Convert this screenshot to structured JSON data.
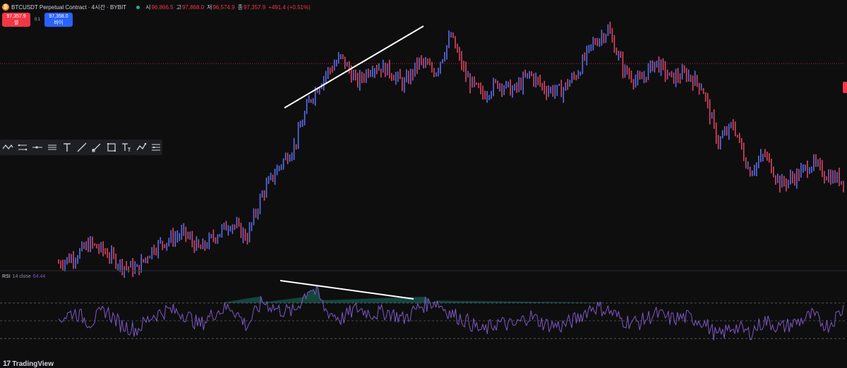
{
  "header": {
    "symbol_icon": "bitcoin-icon",
    "title": "BTCUSDT Perpetual Contract · 4시간 · BYBIT",
    "ohlc": [
      {
        "label": "시",
        "value": "96,866.5"
      },
      {
        "label": "고",
        "value": "97,868.0"
      },
      {
        "label": "저",
        "value": "96,574.9"
      },
      {
        "label": "종",
        "value": "97,357.9"
      }
    ],
    "change": "+491.4 (+0.51%)"
  },
  "trade": {
    "sell_price": "97,357.9",
    "sell_label": "셀",
    "spread": "0.1",
    "buy_price": "97,358.0",
    "buy_label": "바이"
  },
  "toolbar": {
    "icons": [
      "pattern-icon",
      "channel-icon",
      "horizontal-ray-icon",
      "parallel-lines-icon",
      "text-icon",
      "trend-line-icon",
      "brush-icon",
      "rectangle-icon",
      "text-size-icon",
      "path-icon",
      "settings-lines-icon"
    ]
  },
  "rsi": {
    "name": "RSI",
    "params": "14 close",
    "value": "64.44"
  },
  "logo": {
    "text": "TradingView"
  },
  "colors": {
    "background": "#0e0e0f",
    "up": "#5b6ee8",
    "down": "#e0455e",
    "rsi_line": "#7e57c2",
    "trendline": "#ffffff",
    "price_line": "#f23645"
  },
  "chart_data": [
    {
      "type": "line",
      "title": "BTCUSDT Perpetual Contract · 4시간 · BYBIT",
      "x_index_range": [
        0,
        100
      ],
      "series": [
        {
          "name": "BTCUSDT",
          "x": [
            0,
            2,
            4,
            6,
            8,
            10,
            12,
            14,
            16,
            18,
            20,
            22,
            24,
            26,
            28,
            30,
            32,
            33,
            34,
            36,
            38,
            40,
            42,
            44,
            46,
            48,
            50,
            52,
            54,
            56,
            58,
            60,
            62,
            64,
            66,
            68,
            70,
            72,
            74,
            76,
            78,
            80,
            82,
            84,
            86,
            88,
            90,
            92,
            94,
            96,
            98,
            100
          ],
          "values": [
            3,
            6,
            12,
            8,
            2,
            0,
            10,
            14,
            17,
            9,
            16,
            22,
            15,
            36,
            48,
            58,
            80,
            86,
            92,
            100,
            88,
            96,
            94,
            87,
            98,
            93,
            110,
            90,
            82,
            88,
            84,
            92,
            85,
            84,
            92,
            106,
            113,
            94,
            88,
            98,
            90,
            92,
            86,
            60,
            68,
            46,
            54,
            40,
            44,
            50,
            44,
            42
          ]
        }
      ],
      "price_line_value": 97
    },
    {
      "type": "line",
      "title": "RSI 14 close",
      "ylim": [
        0,
        100
      ],
      "series": [
        {
          "name": "RSI",
          "x": [
            0,
            2,
            4,
            6,
            8,
            10,
            12,
            14,
            16,
            18,
            20,
            22,
            24,
            26,
            28,
            30,
            32,
            33,
            34,
            36,
            38,
            40,
            42,
            44,
            46,
            48,
            50,
            52,
            54,
            56,
            58,
            60,
            62,
            64,
            66,
            68,
            70,
            72,
            74,
            76,
            78,
            80,
            82,
            84,
            86,
            88,
            90,
            92,
            94,
            96,
            98,
            100
          ],
          "values": [
            52,
            60,
            48,
            62,
            45,
            40,
            56,
            62,
            58,
            45,
            60,
            66,
            44,
            72,
            62,
            60,
            88,
            80,
            62,
            52,
            64,
            58,
            60,
            52,
            66,
            72,
            58,
            50,
            38,
            48,
            44,
            56,
            46,
            44,
            52,
            66,
            62,
            50,
            48,
            58,
            52,
            54,
            50,
            32,
            44,
            36,
            50,
            42,
            48,
            56,
            44,
            64
          ]
        }
      ],
      "reference_lines": [
        70,
        50,
        30
      ]
    }
  ]
}
